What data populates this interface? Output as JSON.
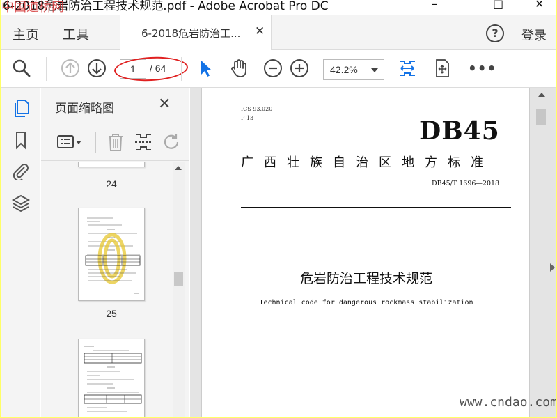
{
  "window": {
    "title": "6-2018危岩防治工程技术规范.pdf - Adobe Acrobat Pro DC",
    "watermark_tl": "中国道桥网",
    "minimize": "–",
    "maximize": "□",
    "close": "✕"
  },
  "menubar": {
    "home": "主页",
    "tools": "工具",
    "doc_tab_label": "6-2018危岩防治工...",
    "tab_close": "✕",
    "help": "?",
    "login": "登录"
  },
  "toolbar": {
    "page_current": "1",
    "page_total": "/ 64",
    "zoom": "42.2%"
  },
  "thumbnails_panel": {
    "title": "页面缩略图",
    "close": "✕",
    "pages": [
      {
        "label": "24"
      },
      {
        "label": "25"
      }
    ]
  },
  "document": {
    "ics": "ICS  93.020",
    "p_code": "P 13",
    "standard_code": "DB45",
    "standard_category": "广西壮族自治区地方标准",
    "standard_number": "DB45/T 1696—2018",
    "title_cn": "危岩防治工程技术规范",
    "title_en": "Technical code for dangerous rockmass stabilization"
  },
  "watermark_br": "www.cndao.com"
}
